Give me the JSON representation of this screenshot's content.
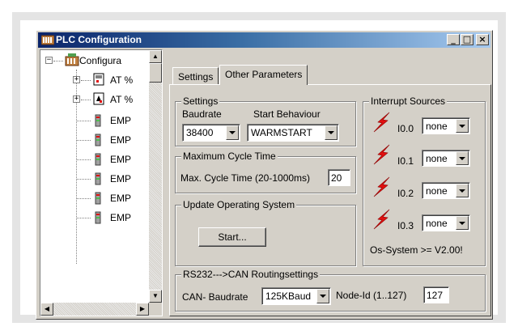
{
  "window": {
    "title": "PLC Configuration",
    "minimize": "_",
    "maximize": "□",
    "close": "×"
  },
  "tree": {
    "root": "Configura",
    "items": [
      {
        "label": "AT %",
        "icon": "module-in-icon",
        "expandable": true
      },
      {
        "label": "AT %",
        "icon": "module-out-icon",
        "expandable": true
      },
      {
        "label": "EMP",
        "icon": "empty-slot-icon"
      },
      {
        "label": "EMP",
        "icon": "empty-slot-icon"
      },
      {
        "label": "EMP",
        "icon": "empty-slot-icon"
      },
      {
        "label": "EMP",
        "icon": "empty-slot-icon"
      },
      {
        "label": "EMP",
        "icon": "empty-slot-icon"
      },
      {
        "label": "EMP",
        "icon": "empty-slot-icon"
      }
    ]
  },
  "tabs": [
    {
      "label": "Settings",
      "active": false
    },
    {
      "label": "Other Parameters",
      "active": true
    }
  ],
  "settings_group": {
    "title": "Settings",
    "baudrate_label": "Baudrate",
    "start_label": "Start Behaviour",
    "baudrate_value": "38400",
    "start_value": "WARMSTART"
  },
  "cycle_group": {
    "title": "Maximum Cycle Time",
    "label": "Max. Cycle Time (20-1000ms)",
    "value": "20"
  },
  "os_group": {
    "title": "Update Operating System",
    "button": "Start..."
  },
  "interrupt_group": {
    "title": "Interrupt Sources",
    "sources": [
      {
        "label": "I0.0",
        "value": "none"
      },
      {
        "label": "I0.1",
        "value": "none"
      },
      {
        "label": "I0.2",
        "value": "none"
      },
      {
        "label": "I0.3",
        "value": "none"
      }
    ],
    "note": "Os-System >= V2.00!"
  },
  "can_group": {
    "title": "RS232--->CAN Routingsettings",
    "baud_label": "CAN- Baudrate",
    "baud_value": "125KBaud",
    "node_label": "Node-Id (1..127)",
    "node_value": "127"
  },
  "colors": {
    "titlebar_start": "#0a246a",
    "titlebar_end": "#a6caf0",
    "face": "#d4d0c8",
    "bolt": "#e01010"
  }
}
